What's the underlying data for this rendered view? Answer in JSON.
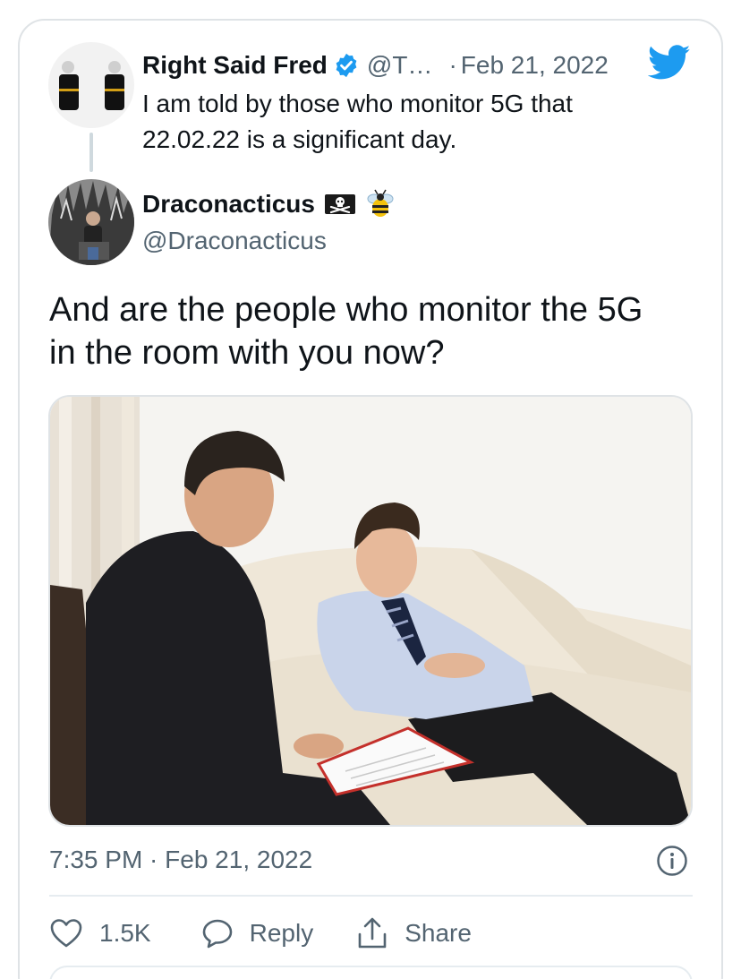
{
  "quoted_tweet": {
    "author_name": "Right Said Fred",
    "handle": "@T…",
    "separator": "·",
    "date": "Feb 21, 2022",
    "verified": true,
    "text": "I am told by those who monitor 5G that\n22.02.22 is a significant day."
  },
  "tweet": {
    "author_name": "Draconacticus",
    "author_emojis": [
      "pirate-flag-icon",
      "bee-icon"
    ],
    "handle": "@Draconacticus",
    "text": "And are the people who monitor the 5G\nin the room with you now?",
    "timestamp": "7:35 PM · Feb 21, 2022"
  },
  "actions": {
    "likes": "1.5K",
    "reply_label": "Reply",
    "share_label": "Share"
  },
  "colors": {
    "twitter_blue": "#1d9bf0",
    "text_primary": "#0f1419",
    "text_secondary": "#536471",
    "border": "#dfe3e6"
  }
}
